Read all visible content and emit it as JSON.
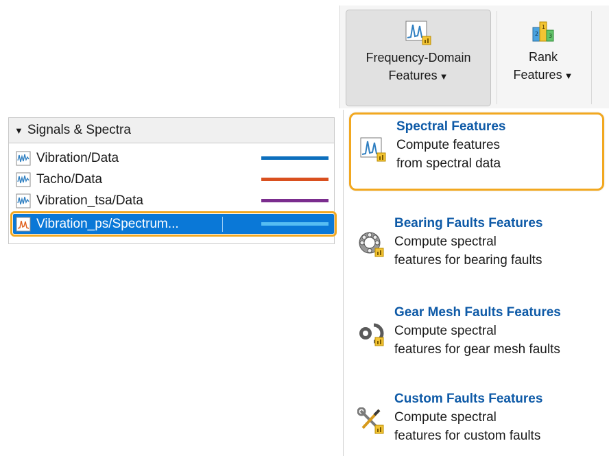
{
  "signals_panel": {
    "header": "Signals & Spectra",
    "items": [
      {
        "name": "Vibration/Data",
        "color": "#0d6fbd",
        "icon": "time-signal-icon"
      },
      {
        "name": "Tacho/Data",
        "color": "#d9501f",
        "icon": "time-signal-icon"
      },
      {
        "name": "Vibration_tsa/Data",
        "color": "#7b2d8e",
        "icon": "time-signal-icon"
      },
      {
        "name": "Vibration_ps/Spectrum...",
        "color": "#56bdf2",
        "icon": "spectrum-icon",
        "selected": true
      }
    ]
  },
  "toolstrip": {
    "freq_button": {
      "line1": "Frequency-Domain",
      "line2": "Features"
    },
    "rank_button": {
      "line1": "Rank",
      "line2": "Features"
    }
  },
  "menu": {
    "items": [
      {
        "title": "Spectral Features",
        "desc1": "Compute features",
        "desc2": "from spectral data",
        "icon": "spectral-features-icon",
        "highlighted": true
      },
      {
        "title": "Bearing Faults Features",
        "desc1": "Compute spectral",
        "desc2": "features for bearing faults",
        "icon": "bearing-icon"
      },
      {
        "title": "Gear Mesh Faults Features",
        "desc1": "Compute spectral",
        "desc2": "features for gear mesh faults",
        "icon": "gear-icon"
      },
      {
        "title": "Custom Faults Features",
        "desc1": "Compute spectral",
        "desc2": "features for custom faults",
        "icon": "wrench-screwdriver-icon"
      }
    ]
  },
  "colors": {
    "selection": "#0a78d7",
    "highlight_outline": "#f2a820",
    "menu_title": "#0e5aa7"
  }
}
